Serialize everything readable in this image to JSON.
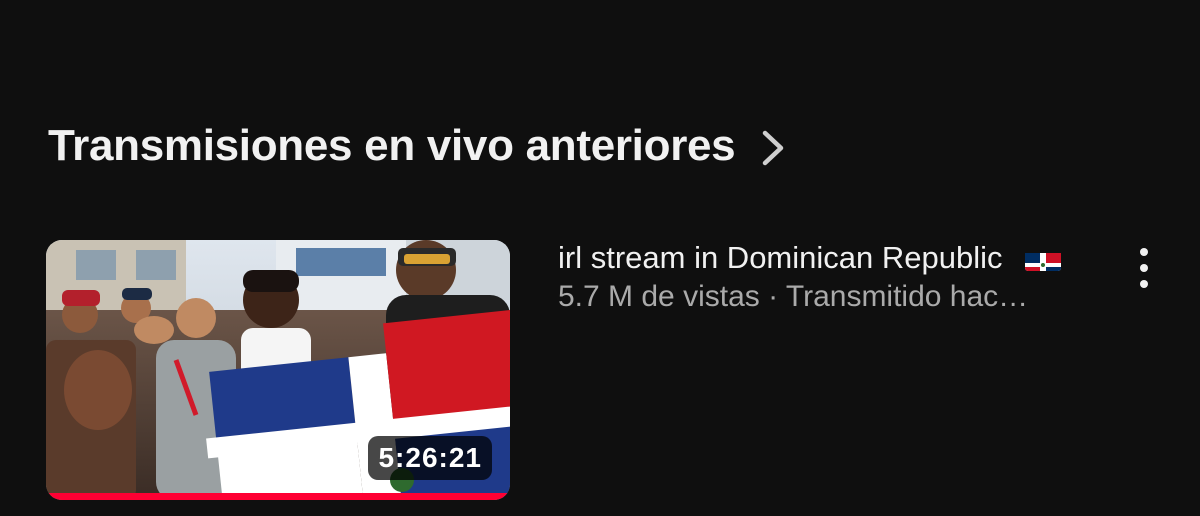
{
  "section": {
    "title": "Transmisiones en vivo anteriores",
    "chevron_icon": "chevron-right-icon"
  },
  "video": {
    "title": "irl stream in Dominican Republic",
    "title_emoji": "dominican-republic-flag",
    "meta": "5.7 M de vistas · Transmitido hac…",
    "duration": "5:26:21",
    "watched_progress": 1.0,
    "more_icon": "more-vertical-icon"
  },
  "colors": {
    "background": "#0f0f0f",
    "text_primary": "#f1f1f1",
    "text_secondary": "#aaaaaa",
    "progress": "#ff0033"
  }
}
